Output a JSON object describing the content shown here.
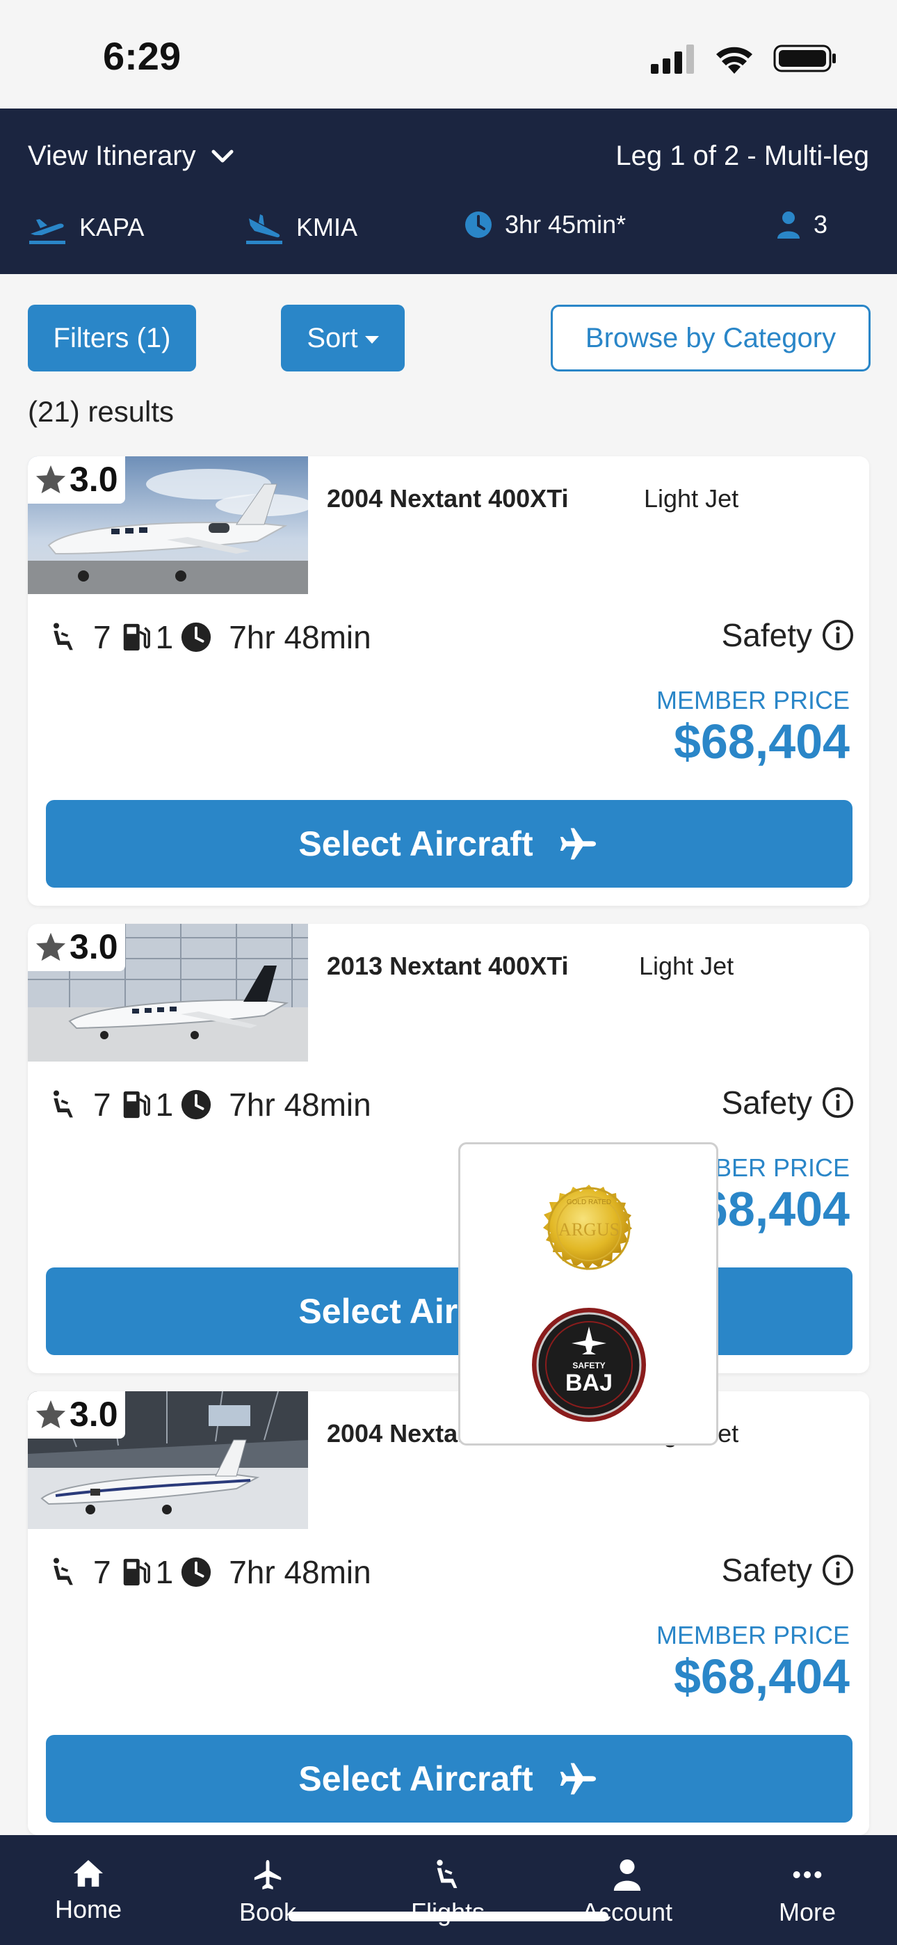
{
  "status": {
    "time": "6:29"
  },
  "header": {
    "itinerary_label": "View Itinerary",
    "leg_label": "Leg 1 of 2 - Multi-leg",
    "departure": "KAPA",
    "arrival": "KMIA",
    "duration": "3hr 45min*",
    "passengers": "3"
  },
  "controls": {
    "filters_label": "Filters (1)",
    "sort_label": "Sort",
    "browse_label": "Browse by Category",
    "results_text": "(21) results"
  },
  "cards": [
    {
      "rating": "3.0",
      "name": "2004 Nextant 400XTi",
      "category": "Light Jet",
      "seats": "7",
      "fuel_stops": "1",
      "flight_time": "7hr 48min",
      "safety_label": "Safety",
      "member_label": "MEMBER PRICE",
      "price": "$68,404",
      "select_label": "Select Aircraft"
    },
    {
      "rating": "3.0",
      "name": "2013 Nextant 400XTi",
      "category": "Light Jet",
      "seats": "7",
      "fuel_stops": "1",
      "flight_time": "7hr 48min",
      "safety_label": "Safety",
      "member_label": "MEMBER PRICE",
      "price": "$68,404",
      "select_label": "Select Aircraft"
    },
    {
      "rating": "3.0",
      "name": "2004 Nextant 400XTi",
      "category": "Light Jet",
      "seats": "7",
      "fuel_stops": "1",
      "flight_time": "7hr 48min",
      "safety_label": "Safety",
      "member_label": "MEMBER PRICE",
      "price": "$68,404",
      "select_label": "Select Aircraft"
    }
  ],
  "safety_popover": {
    "badges": [
      {
        "name": "argus-badge",
        "text": "ARGUS",
        "ring_text": "GOLD RATED"
      },
      {
        "name": "baj-badge",
        "text": "BAJ",
        "ring_text": "SAFETY"
      }
    ]
  },
  "tabbar": {
    "items": [
      {
        "label": "Home",
        "icon": "home-icon"
      },
      {
        "label": "Book",
        "icon": "airplane-icon"
      },
      {
        "label": "Flights",
        "icon": "seat-icon"
      },
      {
        "label": "Account",
        "icon": "person-icon"
      },
      {
        "label": "More",
        "icon": "ellipsis-icon"
      }
    ]
  },
  "colors": {
    "header_bg": "#1b2540",
    "accent": "#2a86c8",
    "background": "#f5f5f5"
  }
}
